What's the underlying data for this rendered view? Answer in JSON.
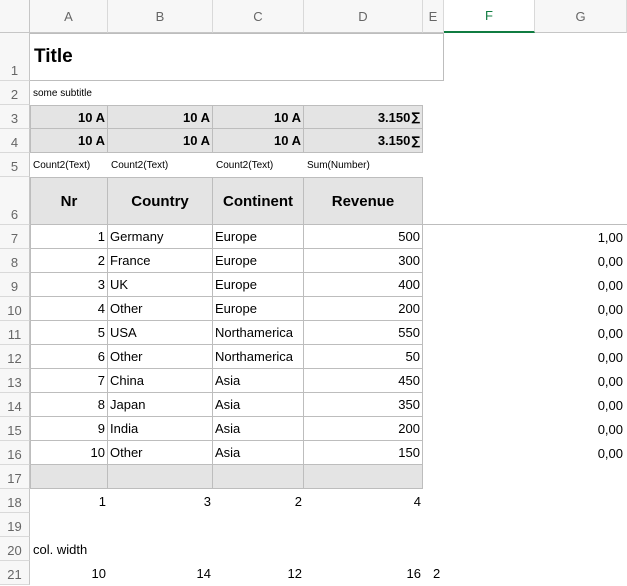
{
  "columns": [
    "A",
    "B",
    "C",
    "D",
    "E",
    "F",
    "G"
  ],
  "rows": [
    "1",
    "2",
    "3",
    "4",
    "5",
    "6",
    "7",
    "8",
    "9",
    "10",
    "11",
    "12",
    "13",
    "14",
    "15",
    "16",
    "17",
    "18",
    "19",
    "20",
    "21"
  ],
  "title": "Title",
  "subtitle": "some subtitle",
  "summary_rows": [
    {
      "a": "10 A",
      "b": "10 A",
      "c": "10 A",
      "d": "3.150",
      "d_sym": "∑"
    },
    {
      "a": "10 A",
      "b": "10 A",
      "c": "10 A",
      "d": "3.150",
      "d_sym": "∑"
    }
  ],
  "aggregates": {
    "a": "Count2(Text)",
    "b": "Count2(Text)",
    "c": "Count2(Text)",
    "d": "Sum(Number)"
  },
  "headers": {
    "nr": "Nr",
    "country": "Country",
    "continent": "Continent",
    "revenue": "Revenue"
  },
  "data_rows": [
    {
      "nr": "1",
      "country": "Germany",
      "continent": "Europe",
      "revenue": "500",
      "f": "1,00"
    },
    {
      "nr": "2",
      "country": "France",
      "continent": "Europe",
      "revenue": "300",
      "f": "0,00"
    },
    {
      "nr": "3",
      "country": "UK",
      "continent": "Europe",
      "revenue": "400",
      "f": "0,00"
    },
    {
      "nr": "4",
      "country": "Other",
      "continent": "Europe",
      "revenue": "200",
      "f": "0,00"
    },
    {
      "nr": "5",
      "country": "USA",
      "continent": "Northamerica",
      "revenue": "550",
      "f": "0,00"
    },
    {
      "nr": "6",
      "country": "Other",
      "continent": "Northamerica",
      "revenue": "50",
      "f": "0,00"
    },
    {
      "nr": "7",
      "country": "China",
      "continent": "Asia",
      "revenue": "450",
      "f": "0,00"
    },
    {
      "nr": "8",
      "country": "Japan",
      "continent": "Asia",
      "revenue": "350",
      "f": "0,00"
    },
    {
      "nr": "9",
      "country": "India",
      "continent": "Asia",
      "revenue": "200",
      "f": "0,00"
    },
    {
      "nr": "10",
      "country": "Other",
      "continent": "Asia",
      "revenue": "150",
      "f": "0,00"
    }
  ],
  "row18": {
    "a": "1",
    "b": "3",
    "c": "2",
    "d": "4"
  },
  "col_width_label": "col. width",
  "col_widths": {
    "a": "10",
    "b": "14",
    "c": "12",
    "d": "16",
    "e": "2"
  },
  "colors": {
    "selected_column": "#107c41",
    "table_header_fill": "#e4e4e4"
  }
}
